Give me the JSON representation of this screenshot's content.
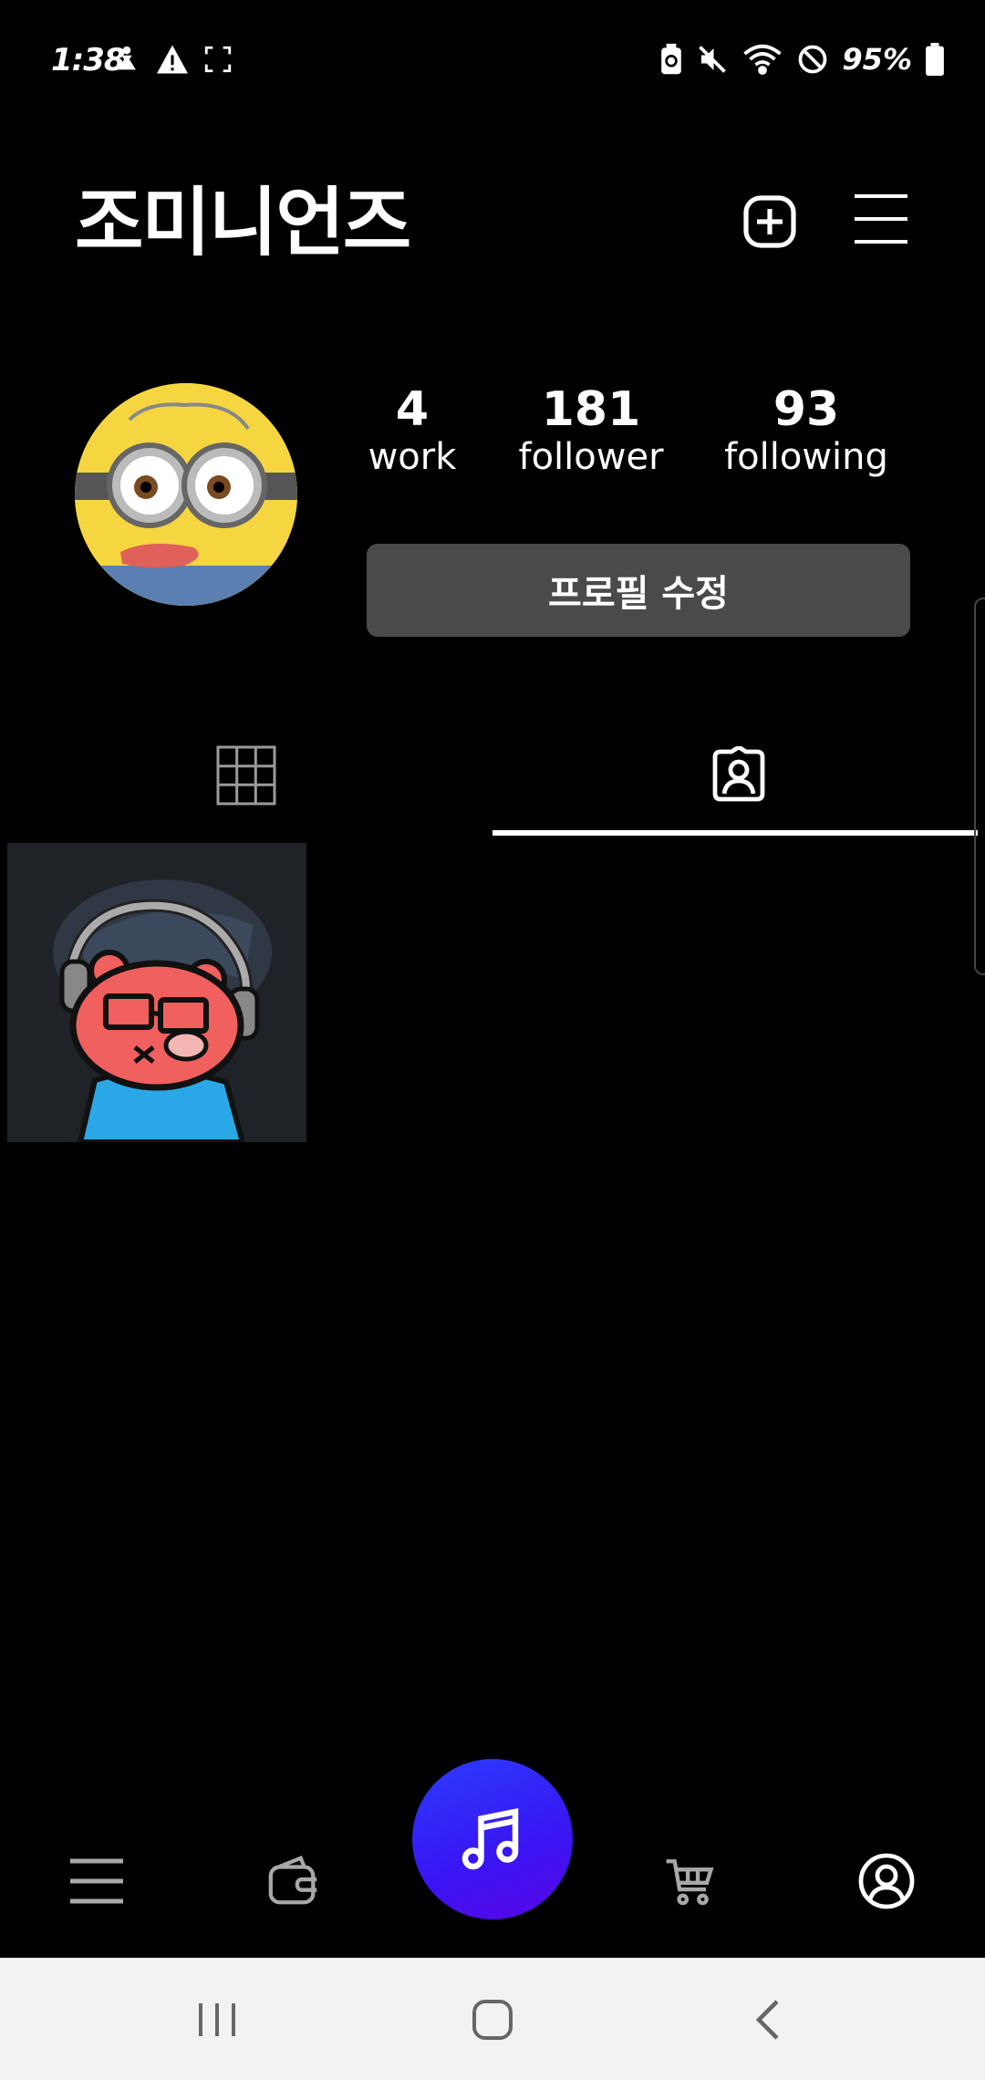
{
  "status_bar": {
    "time": "1:38",
    "battery": "95%",
    "left_icons": [
      "accessibility-icon",
      "warning-icon",
      "screenshot-frame-icon"
    ],
    "right_icons": [
      "battery-saver-icon",
      "mute-icon",
      "wifi-icon",
      "do-not-disturb-icon",
      "battery-icon"
    ]
  },
  "header": {
    "title": "조미니언즈",
    "add_icon": "plus-square-icon",
    "menu_icon": "hamburger-icon"
  },
  "profile": {
    "stats": [
      {
        "value": "4",
        "label": "work"
      },
      {
        "value": "181",
        "label": "follower"
      },
      {
        "value": "93",
        "label": "following"
      }
    ],
    "edit_button": "프로필 수정"
  },
  "tabs": [
    {
      "icon": "grid-icon",
      "selected": false
    },
    {
      "icon": "tagged-user-icon",
      "selected": true
    }
  ],
  "colors": {
    "background": "#000000",
    "edit_button_bg": "#4a4a4a",
    "fab_gradient_start": "#2a3cff",
    "fab_gradient_end": "#5a05e8",
    "system_nav_bg": "#f2f2f2"
  },
  "bottom_nav": [
    "menu-icon",
    "wallet-icon",
    "music-note-icon",
    "cart-icon",
    "profile-circle-icon"
  ],
  "system_nav": [
    "recent-apps-icon",
    "home-icon",
    "back-icon"
  ]
}
